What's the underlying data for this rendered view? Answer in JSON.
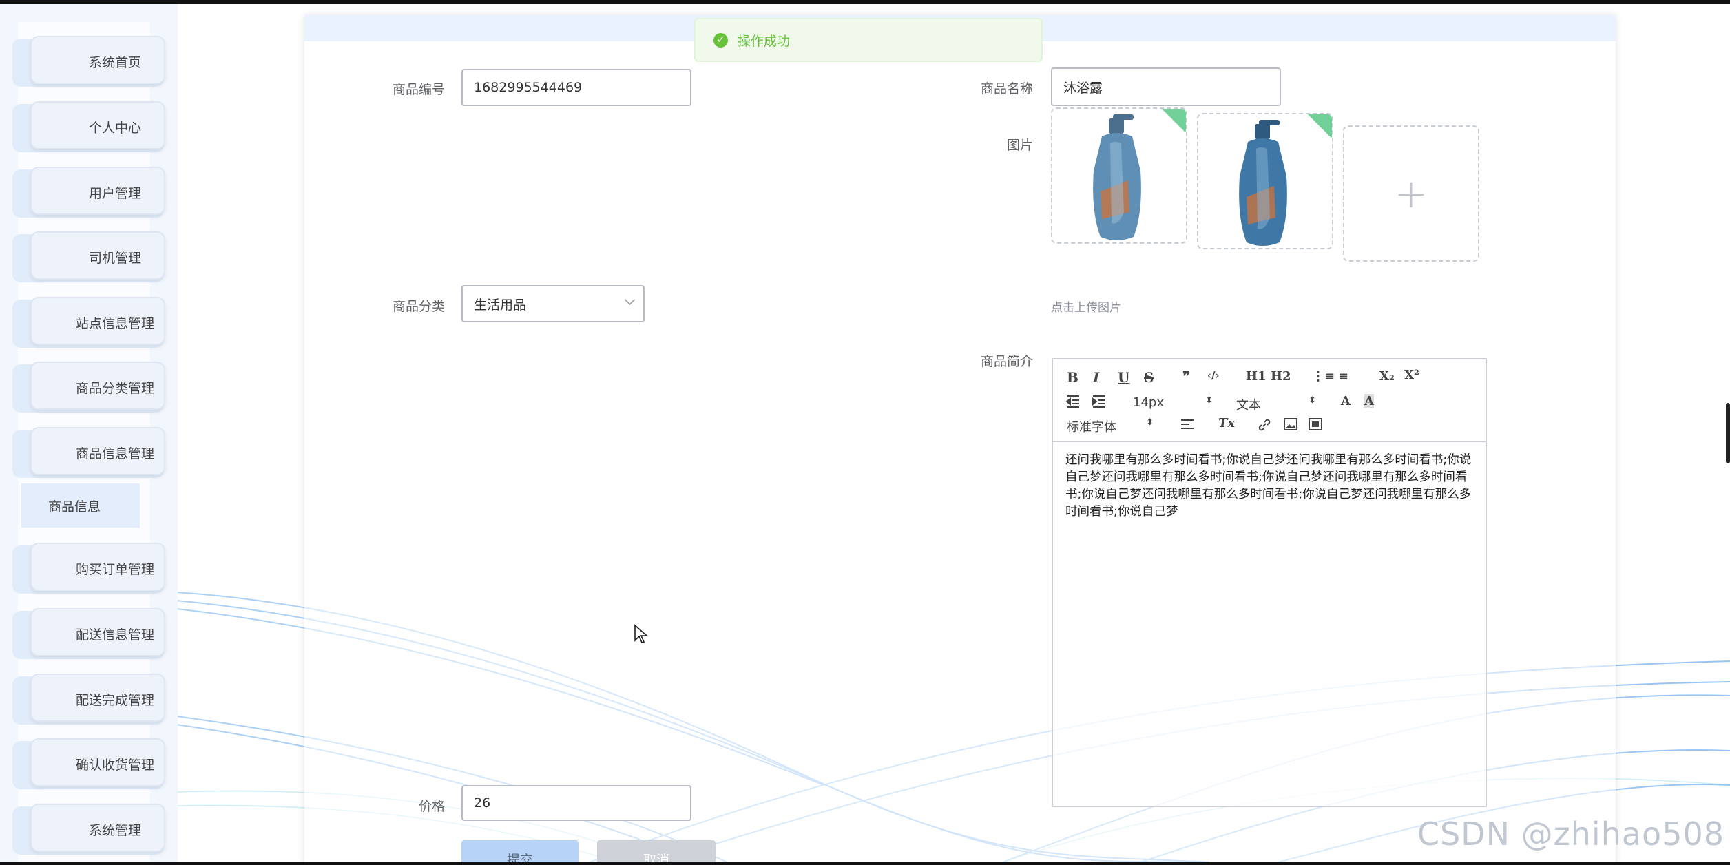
{
  "sidebar": {
    "items": [
      {
        "label": "系统首页"
      },
      {
        "label": "个人中心"
      },
      {
        "label": "用户管理"
      },
      {
        "label": "司机管理"
      },
      {
        "label": "站点信息管理"
      },
      {
        "label": "商品分类管理"
      },
      {
        "label": "商品信息管理"
      },
      {
        "label": "购买订单管理"
      },
      {
        "label": "配送信息管理"
      },
      {
        "label": "配送完成管理"
      },
      {
        "label": "确认收货管理"
      },
      {
        "label": "系统管理"
      }
    ],
    "submenu": {
      "label": "商品信息"
    }
  },
  "toast": {
    "message": "操作成功",
    "type": "success",
    "color": "#67c23a"
  },
  "form": {
    "code": {
      "label": "商品编号",
      "value": "1682995544469"
    },
    "name": {
      "label": "商品名称",
      "value": "沐浴露"
    },
    "images": {
      "label": "图片",
      "count": 2,
      "hint": "点击上传图片",
      "add_icon": "+"
    },
    "category": {
      "label": "商品分类",
      "value": "生活用品"
    },
    "intro": {
      "label": "商品简介",
      "content": "还问我哪里有那么多时间看书;你说自己梦还问我哪里有那么多时间看书;你说自己梦还问我哪里有那么多时间看书;你说自己梦还问我哪里有那么多时间看书;你说自己梦还问我哪里有那么多时间看书;你说自己梦还问我哪里有那么多时间看书;你说自己梦"
    },
    "price": {
      "label": "价格",
      "value": "26"
    }
  },
  "editor_toolbar": {
    "bold": "B",
    "italic": "I",
    "underline": "U",
    "strike": "S",
    "blockquote": "❞",
    "code": "‹/›",
    "h1": "H1",
    "h2": "H2",
    "ordered_list": "⋮≡",
    "bullet_list": "≡",
    "subscript": "X₂",
    "superscript": "X²",
    "size": "14px",
    "header": "文本",
    "font": "标准字体",
    "color": "A",
    "background": "A",
    "clean": "Tx"
  },
  "buttons": {
    "submit": "提交",
    "cancel": "取消"
  },
  "watermark": "CSDN @zhihao508",
  "colors": {
    "accent": "#409eff",
    "success": "#67c23a",
    "tag": "#72d199"
  }
}
